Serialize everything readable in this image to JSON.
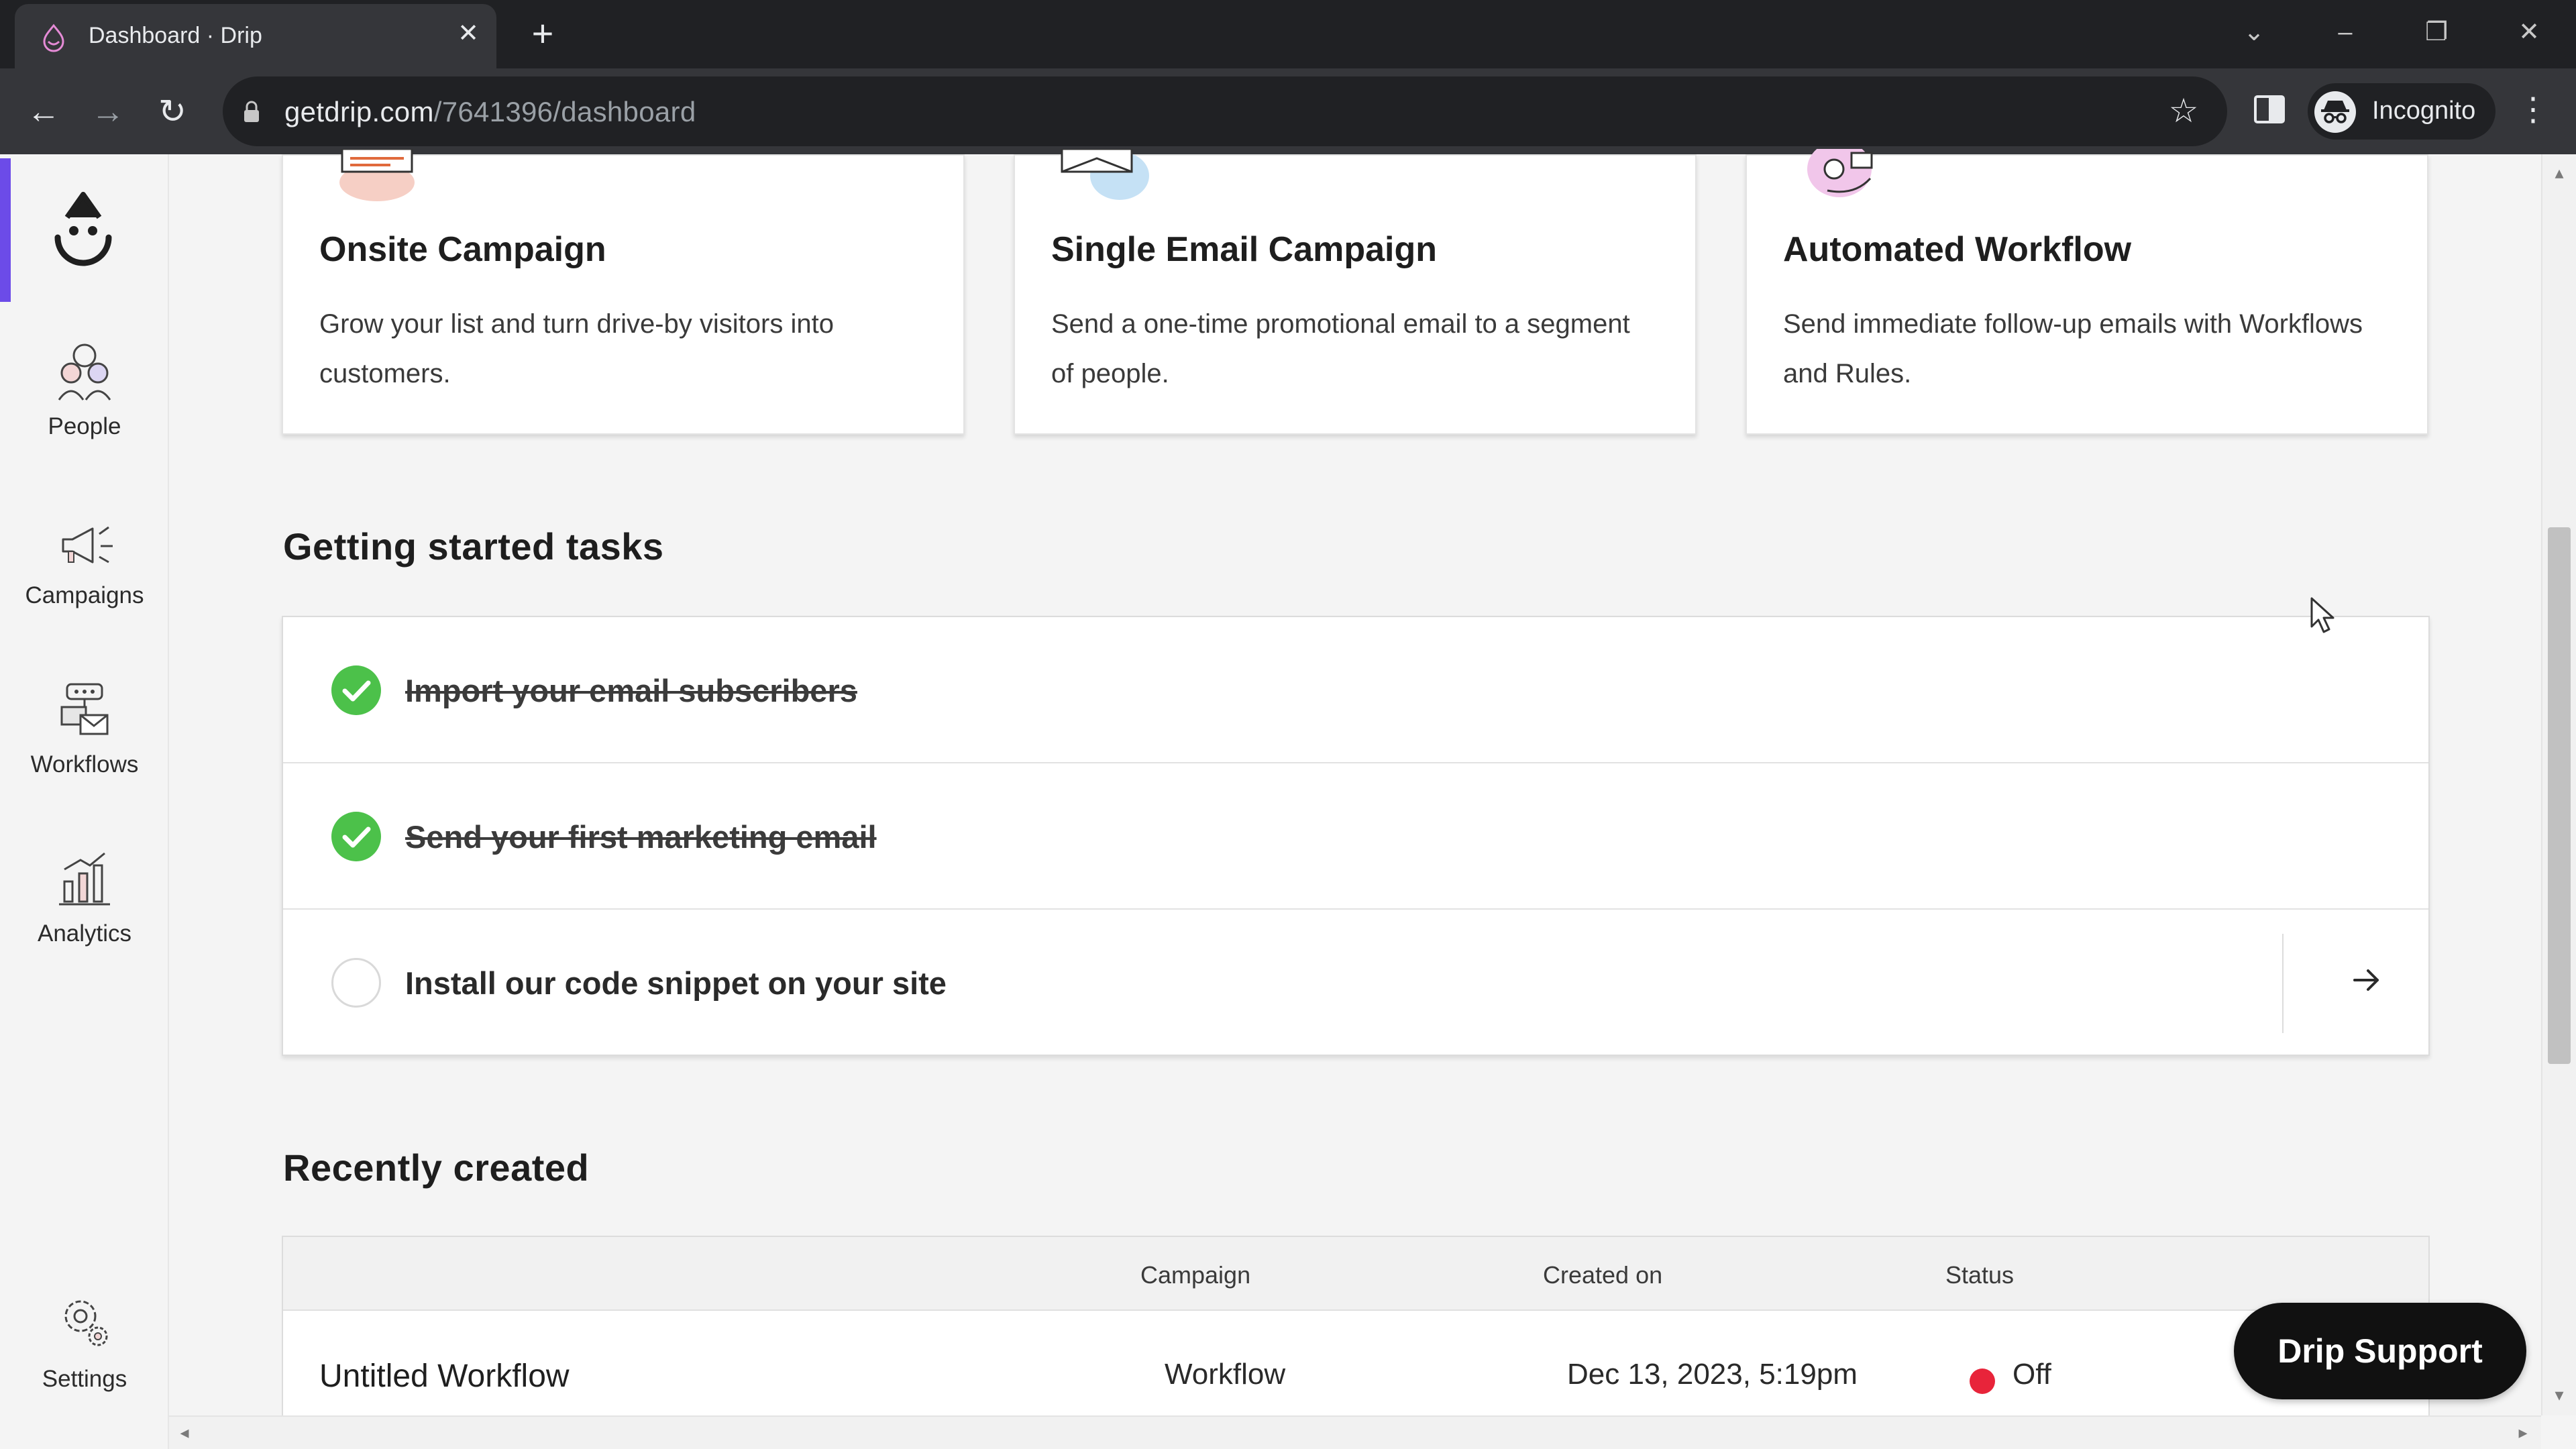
{
  "browser": {
    "tab_title": "Dashboard · Drip",
    "tab_close": "✕",
    "new_tab": "+",
    "url_host": "getdrip.com",
    "url_path": "/7641396/dashboard",
    "profile_label": "Incognito",
    "icons": [
      "back-icon",
      "forward-icon",
      "reload-icon",
      "lock-icon",
      "star-icon",
      "side-panel-icon",
      "incognito-icon",
      "kebab-menu-icon",
      "minimize-icon",
      "restore-icon",
      "close-icon",
      "tab-search-icon"
    ]
  },
  "sidebar": {
    "items": [
      {
        "label": "People",
        "icon": "people-icon"
      },
      {
        "label": "Campaigns",
        "icon": "megaphone-icon"
      },
      {
        "label": "Workflows",
        "icon": "workflow-icon"
      },
      {
        "label": "Analytics",
        "icon": "bar-chart-icon"
      },
      {
        "label": "Settings",
        "icon": "gear-icon"
      }
    ]
  },
  "cards": [
    {
      "title": "Onsite Campaign",
      "description": "Grow your list and turn drive-by visitors into customers."
    },
    {
      "title": "Single Email Campaign",
      "description": "Send a one-time promotional email to a segment of people."
    },
    {
      "title": "Automated Workflow",
      "description": "Send immediate follow-up emails with Workflows and Rules."
    }
  ],
  "tasks": {
    "title": "Getting started tasks",
    "items": [
      {
        "label": "Import your email subscribers",
        "done": true
      },
      {
        "label": "Send your first marketing email",
        "done": true
      },
      {
        "label": "Install our code snippet on your site",
        "done": false
      }
    ]
  },
  "recent": {
    "title": "Recently created",
    "columns": [
      "Campaign",
      "Created on",
      "Status"
    ],
    "rows": [
      {
        "name": "Untitled Workflow",
        "campaign": "Workflow",
        "created_on": "Dec 13, 2023, 5:19pm",
        "status": "Off"
      }
    ]
  },
  "support_button": "Drip Support",
  "colors": {
    "accent": "#6c4be8",
    "done_green": "#4cc14a",
    "status_off": "#e8243a"
  }
}
